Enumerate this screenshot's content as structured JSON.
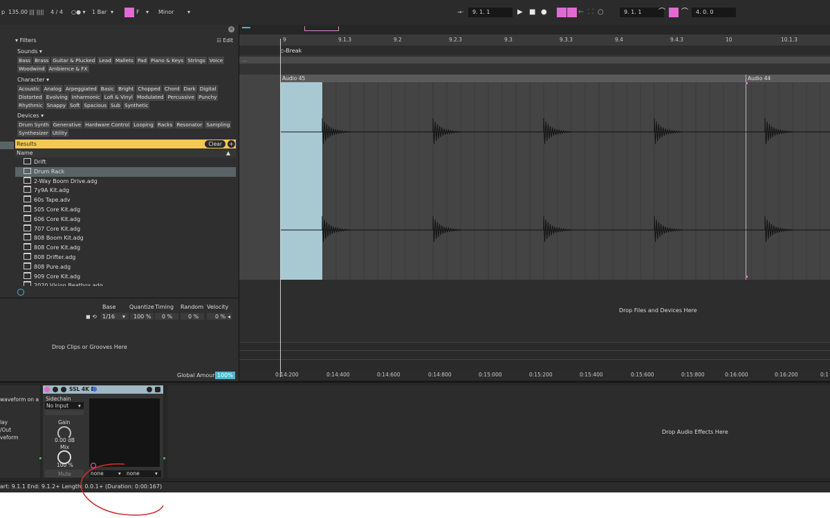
{
  "topbar": {
    "tempo": "135.00",
    "time_sig": "4 / 4",
    "quantize": "1 Bar",
    "key": "F",
    "scale": "Minor",
    "position": "9.  1.  1",
    "loop_start": "9.  1.  1",
    "loop_length": "4.  0.  0"
  },
  "browser": {
    "filters_label": "Filters",
    "edit_label": "Edit",
    "sounds_label": "Sounds",
    "sounds": [
      "Bass",
      "Brass",
      "Guitar & Plucked",
      "Lead",
      "Mallets",
      "Pad",
      "Piano & Keys",
      "Strings",
      "Voice",
      "Woodwind",
      "Ambience & FX"
    ],
    "character_label": "Character",
    "character": [
      "Acoustic",
      "Analog",
      "Arpeggiated",
      "Basic",
      "Bright",
      "Chopped",
      "Chord",
      "Dark",
      "Digital",
      "Distorted",
      "Evolving",
      "Inharmonic",
      "Lofi & Vinyl",
      "Modulated",
      "Percussive",
      "Punchy",
      "Rhythmic",
      "Snappy",
      "Soft",
      "Spacious",
      "Sub",
      "Synthetic"
    ],
    "devices_label": "Devices",
    "devices": [
      "Drum Synth",
      "Generative",
      "Hardware Control",
      "Looping",
      "Racks",
      "Resonator",
      "Sampling",
      "Synthesizer",
      "Utility"
    ],
    "results_label": "Results",
    "clear_label": "Clear",
    "name_col": "Name",
    "items": [
      "Drift",
      "Drum Rack",
      "2-Way Boom Drive.adg",
      "7y9A Kit.adg",
      "60s Tape.adv",
      "505 Core Kit.adg",
      "606 Core Kit.adg",
      "707 Core Kit.adg",
      "808 Boom Kit.adg",
      "808 Core Kit.adg",
      "808 Drifter.adg",
      "808 Pure.adg",
      "909 Core Kit.adg",
      "2020 Vision Beatbox.adg"
    ],
    "selected_index": 1
  },
  "groove": {
    "headers": [
      "Base",
      "Quantize",
      "Timing",
      "Random",
      "Velocity"
    ],
    "base": "1/16",
    "quantize": "100 %",
    "timing": "0 %",
    "random": "0 %",
    "velocity": "0 %",
    "drop_text": "Drop Clips or Grooves Here",
    "global_label": "Global Amount",
    "global_value": "100%"
  },
  "arrangement": {
    "bar_labels": [
      "9",
      "9.1.3",
      "9.2",
      "9.2.3",
      "9.3",
      "9.3.3",
      "9.4",
      "9.4.3",
      "10",
      "10.1.3"
    ],
    "locator": "Break",
    "clip1": "Audio 45",
    "clip2": "Audio 44",
    "drop_text": "Drop Files and Devices Here",
    "time_labels": [
      "0:14:200",
      "0:14:400",
      "0:14:600",
      "0:14:800",
      "0:15:000",
      "0:15:200",
      "0:15:400",
      "0:15:600",
      "0:15:800",
      "0:16:000",
      "0:16:200",
      "0:1"
    ]
  },
  "device": {
    "info_lines": [
      "waveform on a",
      "lay",
      "/Out",
      "veform"
    ],
    "name": "SSL 4K B",
    "sidechain_label": "Sidechain",
    "sidechain_value": "No Input",
    "gain_label": "Gain",
    "gain_value": "0.00 dB",
    "mix_label": "Mix",
    "mix_value": "100 %",
    "mute_label": "Mute",
    "dd1": "none",
    "dd2": "none",
    "drop_text": "Drop Audio Effects Here"
  },
  "status": "art: 9.1.1   End: 9.1.2+   Length: 0.0.1+ (Duration: 0:00:167)"
}
